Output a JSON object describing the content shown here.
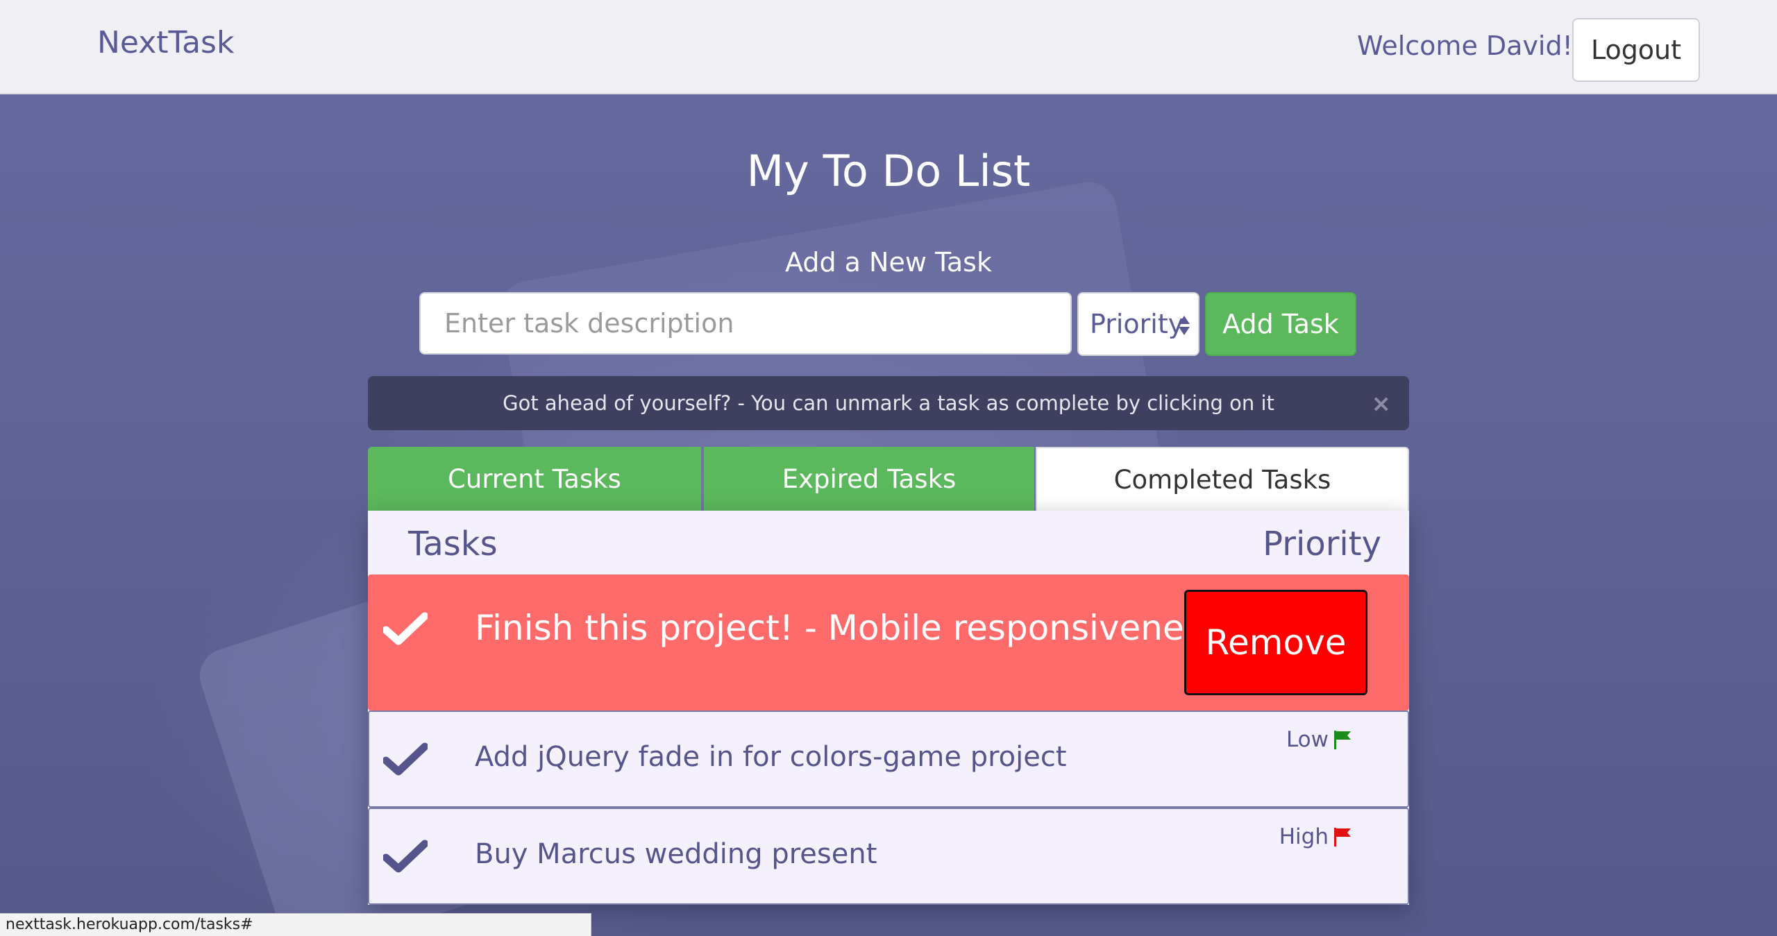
{
  "navbar": {
    "brand": "NextTask",
    "welcome": "Welcome David!",
    "logout_label": "Logout"
  },
  "page_title": "My To Do List",
  "add_form": {
    "label": "Add a New Task",
    "input_placeholder": "Enter task description",
    "input_value": "",
    "priority_selected": "Priority",
    "add_button": "Add Task"
  },
  "alert": {
    "message": "Got ahead of yourself? - You can unmark a task as complete by clicking on it",
    "close_glyph": "×"
  },
  "tabs": [
    {
      "label": "Current Tasks",
      "active": false
    },
    {
      "label": "Expired Tasks",
      "active": false
    },
    {
      "label": "Completed Tasks",
      "active": true
    }
  ],
  "table": {
    "headers": {
      "tasks": "Tasks",
      "priority": "Priority"
    },
    "rows": [
      {
        "text": "Finish this project! - Mobile responsiveness",
        "state": "hovered",
        "action": "Remove",
        "priority": ""
      },
      {
        "text": "Add jQuery fade in for colors-game project",
        "priority": "Low",
        "flag_color": "#1a8c1a"
      },
      {
        "text": "Buy Marcus wedding present",
        "priority": "High",
        "flag_color": "#e01010"
      }
    ]
  },
  "status_bar": {
    "url": "nexttask.herokuapp.com/tasks#"
  },
  "colors": {
    "accent_green": "#5cb85c",
    "hover_row": "#ff6b6b",
    "remove_red": "#ff0000",
    "text_purple": "#55558c"
  },
  "icons": {
    "check": "check-icon",
    "flag": "flag-icon",
    "close": "close-icon",
    "select_arrows": "select-arrows-icon"
  }
}
